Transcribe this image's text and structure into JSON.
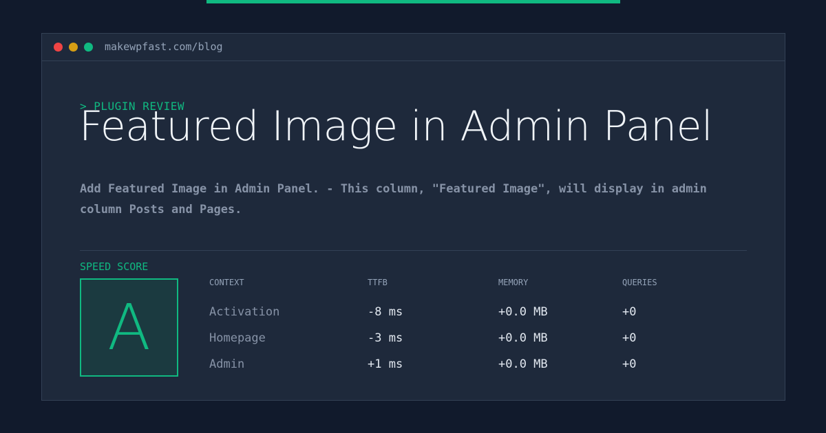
{
  "browser": {
    "url": "makewpfast.com/blog"
  },
  "article": {
    "eyebrow": "> PLUGIN REVIEW",
    "title": "Featured Image in Admin Panel",
    "description": "Add Featured Image in Admin Panel. - This column, \"Featured Image\", will display in admin column Posts and Pages."
  },
  "score": {
    "label": "SPEED SCORE",
    "grade": "A"
  },
  "metrics": {
    "headers": [
      "CONTEXT",
      "TTFB",
      "MEMORY",
      "QUERIES"
    ],
    "rows": [
      {
        "context": "Activation",
        "ttfb": "-8 ms",
        "memory": "+0.0 MB",
        "queries": "+0"
      },
      {
        "context": "Homepage",
        "ttfb": "-3 ms",
        "memory": "+0.0 MB",
        "queries": "+0"
      },
      {
        "context": "Admin",
        "ttfb": "+1 ms",
        "memory": "+0.0 MB",
        "queries": "+0"
      }
    ]
  },
  "colors": {
    "accent": "#10b981",
    "background": "#111a2c",
    "card": "#1e293b",
    "dot_red": "#ef4444",
    "dot_yellow": "#d69e14",
    "dot_green": "#10b981"
  },
  "icons": [
    "close-dot-icon",
    "minimize-dot-icon",
    "maximize-dot-icon"
  ]
}
